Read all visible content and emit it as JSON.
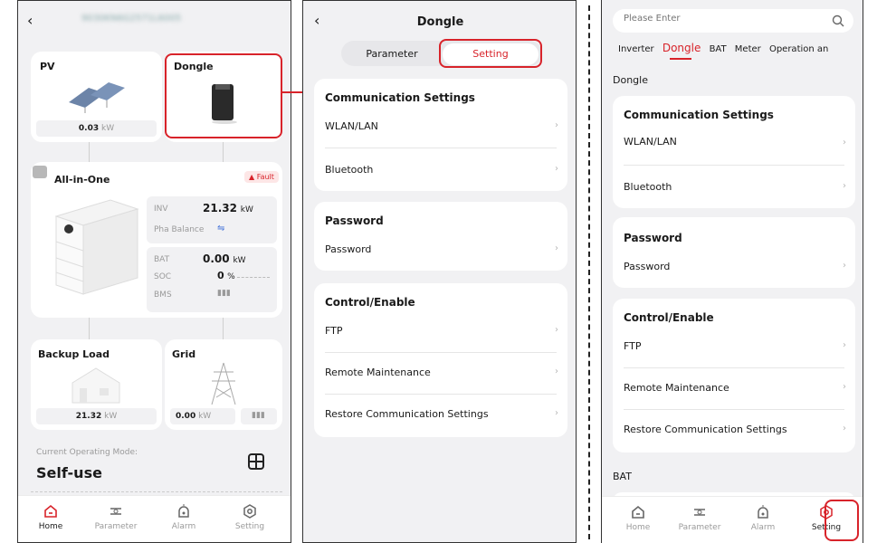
{
  "home": {
    "device_serial": "9030KN6G2571L6005",
    "pv": {
      "label": "PV",
      "value": "0.03",
      "unit": "kW"
    },
    "dongle": {
      "label": "Dongle"
    },
    "aio": {
      "label": "All-in-One",
      "fault_label": "Fault",
      "inv_label": "INV",
      "inv_value": "21.32",
      "inv_unit": "kW",
      "pha_label": "Pha Balance",
      "bat_label": "BAT",
      "bat_value": "0.00",
      "bat_unit": "kW",
      "soc_label": "SOC",
      "soc_value": "0",
      "soc_unit": "%",
      "bms_label": "BMS"
    },
    "backup": {
      "label": "Backup Load",
      "value": "21.32",
      "unit": "kW"
    },
    "grid": {
      "label": "Grid",
      "value": "0.00",
      "unit": "kW"
    },
    "mode_label": "Current Operating Mode:",
    "mode_value": "Self-use"
  },
  "nav": {
    "home": "Home",
    "parameter": "Parameter",
    "alarm": "Alarm",
    "setting": "Setting"
  },
  "dongle_page": {
    "title": "Dongle",
    "tab_parameter": "Parameter",
    "tab_setting": "Setting"
  },
  "sections": {
    "comm_title": "Communication Settings",
    "wlan": "WLAN/LAN",
    "bluetooth": "Bluetooth",
    "pwd_title": "Password",
    "pwd": "Password",
    "ctrl_title": "Control/Enable",
    "ftp": "FTP",
    "remote": "Remote Maintenance",
    "restore": "Restore Communication Settings"
  },
  "search_page": {
    "placeholder": "Please Enter",
    "tabs": [
      "Inverter",
      "Dongle",
      "BAT",
      "Meter",
      "Operation an"
    ],
    "section_dongle": "Dongle",
    "section_bat": "BAT"
  },
  "colors": {
    "accent": "#d8232a",
    "card": "#ffffff",
    "background": "#f1f1f3"
  }
}
